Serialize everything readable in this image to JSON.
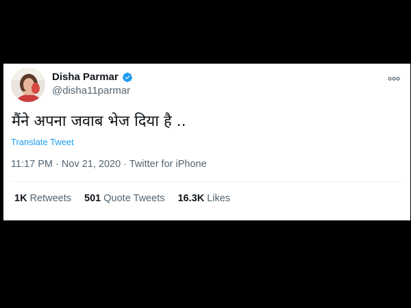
{
  "colors": {
    "background": "#000000",
    "card": "#ffffff",
    "link_blue": "#1d9bf0",
    "verified_blue": "#1d9bf0",
    "secondary_text": "#536471",
    "primary_text": "#0f1419"
  },
  "author": {
    "avatar_icon": "profile-photo",
    "name": "Disha Parmar",
    "verified_icon": "verified-badge-icon",
    "handle": "@disha11parmar"
  },
  "more_icon": "more-options-icon",
  "tweet": {
    "text": "मैंने अपना जवाब भेज दिया है ..",
    "translate_label": "Translate Tweet",
    "time": "11:17 PM",
    "date": "Nov 21, 2020",
    "separator": "·",
    "source": "Twitter for iPhone"
  },
  "stats": {
    "retweets_count": "1K",
    "retweets_label": "Retweets",
    "quotes_count": "501",
    "quotes_label": "Quote Tweets",
    "likes_count": "16.3K",
    "likes_label": "Likes"
  }
}
